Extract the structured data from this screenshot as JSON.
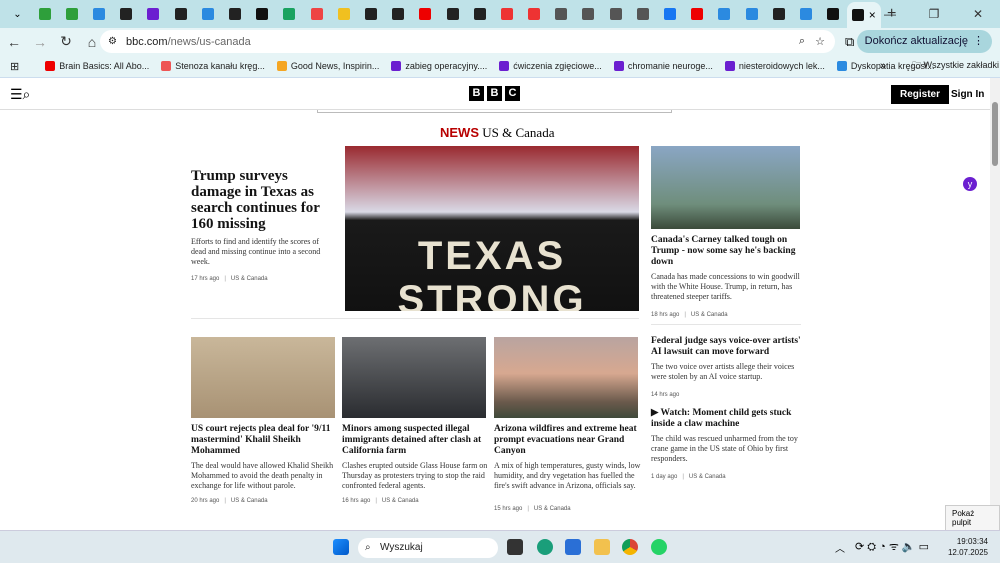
{
  "browser": {
    "tab_favicon_colors": [
      "#2e9f3b",
      "#2e9f3b",
      "#2b8ae0",
      "#222",
      "#6b1fd0",
      "#222",
      "#2b8ae0",
      "#222",
      "#111",
      "#1aa260",
      "#e44",
      "#f0c020",
      "#222",
      "#222",
      "#e00",
      "#222",
      "#222",
      "#e33",
      "#e33",
      "#555",
      "#555",
      "#555",
      "#555",
      "#1877f2",
      "#e00",
      "#2b8ae0",
      "#2b8ae0",
      "#222",
      "#2b8ae0",
      "#111"
    ],
    "active_tab_close": "×",
    "new_tab": "+",
    "window_controls": [
      "—",
      "❐",
      "✕"
    ],
    "url_host": "bbc.com",
    "url_path": "/news/us-canada",
    "update_button": "Dokończ aktualizację",
    "bookmarks": [
      {
        "label": "Brain Basics: All Abo...",
        "color": "#e00"
      },
      {
        "label": "Stenoza kanału kręg...",
        "color": "#e55"
      },
      {
        "label": "Good News, Inspirin...",
        "color": "#f5a623"
      },
      {
        "label": "zabieg operacyjny....",
        "color": "#6b1fd0"
      },
      {
        "label": "ćwiczenia zgięciowe...",
        "color": "#6b1fd0"
      },
      {
        "label": "chromanie neuroge...",
        "color": "#6b1fd0"
      },
      {
        "label": "niesteroidowych lek...",
        "color": "#6b1fd0"
      },
      {
        "label": "Dyskopatia kręgosł...",
        "color": "#2b8ae0"
      }
    ],
    "more_bookmarks": "»",
    "all_bookmarks": "Wszystkie zakładki"
  },
  "bbc": {
    "logo": [
      "B",
      "B",
      "C"
    ],
    "register": "Register",
    "sign_in": "Sign In",
    "section_news": "NEWS",
    "section_name": "US & Canada",
    "lead": {
      "title": "Trump surveys damage in Texas as search continues for 160 missing",
      "summary": "Efforts to find and identify the scores of dead and missing continue into a second week.",
      "time": "17 hrs ago",
      "tag": "US & Canada",
      "image_text": [
        "TEXAS",
        "STRONG"
      ]
    },
    "side": [
      {
        "title": "Canada's Carney talked tough on Trump - now some say he's backing down",
        "summary": "Canada has made concessions to win goodwill with the White House. Trump, in return, has threatened steeper tariffs.",
        "time": "18 hrs ago",
        "tag": "US & Canada"
      },
      {
        "title": "Federal judge says voice-over artists' AI lawsuit can move forward",
        "summary": "The two voice over artists allege their voices were stolen by an AI voice startup.",
        "time": "14 hrs ago"
      },
      {
        "title": "Watch: Moment child gets stuck inside a claw machine",
        "summary": "The child was rescued unharmed from the toy crane game in the US state of Ohio by first responders.",
        "time": "1 day ago",
        "tag": "US & Canada"
      }
    ],
    "grid": [
      {
        "title": "US court rejects plea deal for '9/11 mastermind' Khalil Sheikh Mohammed",
        "summary": "The deal would have allowed Khalid Sheikh Mohammed to avoid the death penalty in exchange for life without parole.",
        "time": "20 hrs ago",
        "tag": "US & Canada"
      },
      {
        "title": "Minors among suspected illegal immigrants detained after clash at California farm",
        "summary": "Clashes erupted outside Glass House farm on Thursday as protesters trying to stop the raid confronted federal agents.",
        "time": "16 hrs ago",
        "tag": "US & Canada"
      },
      {
        "title": "Arizona wildfires and extreme heat prompt evacuations near Grand Canyon",
        "summary": "A mix of high temperatures, gusty winds, low humidity, and dry vegetation has fuelled the fire's swift advance in Arizona, officials say.",
        "time": "15 hrs ago",
        "tag": "US & Canada"
      }
    ]
  },
  "taskbar": {
    "search": "Wyszukaj",
    "time": "19:03:34",
    "date": "12.07.2025",
    "tooltip": "Pokaż pulpit"
  }
}
